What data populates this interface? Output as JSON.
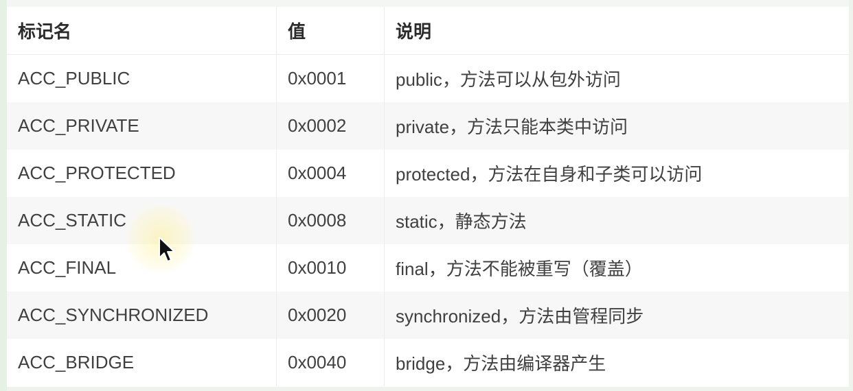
{
  "table": {
    "headers": [
      "标记名",
      "值",
      "说明"
    ],
    "rows": [
      {
        "flag": "ACC_PUBLIC",
        "value": "0x0001",
        "description": "public，方法可以从包外访问"
      },
      {
        "flag": "ACC_PRIVATE",
        "value": "0x0002",
        "description": "private，方法只能本类中访问"
      },
      {
        "flag": "ACC_PROTECTED",
        "value": "0x0004",
        "description": "protected，方法在自身和子类可以访问"
      },
      {
        "flag": "ACC_STATIC",
        "value": "0x0008",
        "description": "static，静态方法"
      },
      {
        "flag": "ACC_FINAL",
        "value": "0x0010",
        "description": "final，方法不能被重写（覆盖）"
      },
      {
        "flag": "ACC_SYNCHRONIZED",
        "value": "0x0020",
        "description": "synchronized，方法由管程同步"
      },
      {
        "flag": "ACC_BRIDGE",
        "value": "0x0040",
        "description": "bridge，方法由编译器产生"
      }
    ]
  },
  "cursor": {
    "icon": "arrow-cursor-icon"
  },
  "colors": {
    "text": "#404040",
    "header_text": "#2b2b2b",
    "stripe": "#f7f7f7",
    "border": "#ececec",
    "left_edge": "#e6f1e5"
  }
}
